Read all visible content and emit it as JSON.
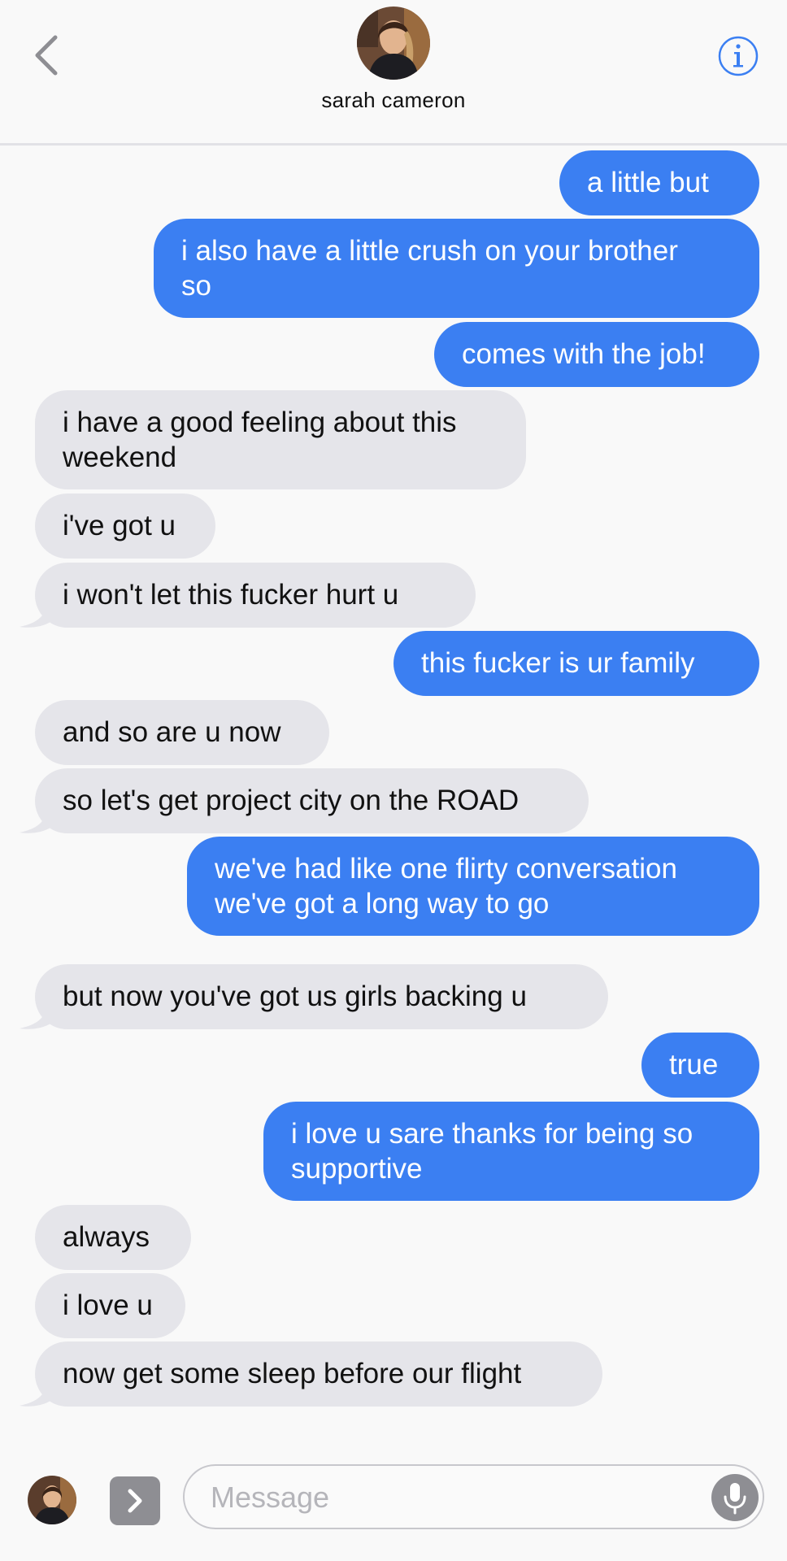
{
  "header": {
    "contact_name": "sarah cameron",
    "back_icon": "chevron-left-icon",
    "info_icon": "info-icon"
  },
  "messages": [
    {
      "dir": "out",
      "text": "a little but"
    },
    {
      "dir": "out",
      "text": "i also have a little crush on your brother\nso"
    },
    {
      "dir": "out",
      "text": "comes with the job!"
    },
    {
      "dir": "in",
      "text": "i have a good feeling about this\nweekend"
    },
    {
      "dir": "in",
      "text": "i've got u"
    },
    {
      "dir": "in",
      "text": "i won't let this fucker hurt u"
    },
    {
      "dir": "out",
      "text": "this fucker is ur family"
    },
    {
      "dir": "in",
      "text": "and so are u now"
    },
    {
      "dir": "in",
      "text": "so let's get project city on the ROAD"
    },
    {
      "dir": "out",
      "text": "we've had like one flirty conversation\nwe've got a long way to go"
    },
    {
      "dir": "in",
      "text": "but now you've got us girls backing u"
    },
    {
      "dir": "out",
      "text": "true"
    },
    {
      "dir": "out",
      "text": "i love u sare thanks for being so\nsupportive"
    },
    {
      "dir": "in",
      "text": "always"
    },
    {
      "dir": "in",
      "text": "i love u"
    },
    {
      "dir": "in",
      "text": "now get some sleep before our flight"
    }
  ],
  "composer": {
    "placeholder": "Message",
    "apps_icon": "chevron-right-icon",
    "mic_icon": "microphone-icon"
  },
  "colors": {
    "outgoing_bubble": "#3b7ff2",
    "incoming_bubble": "#e5e5ea",
    "accent": "#3b7ff2"
  }
}
